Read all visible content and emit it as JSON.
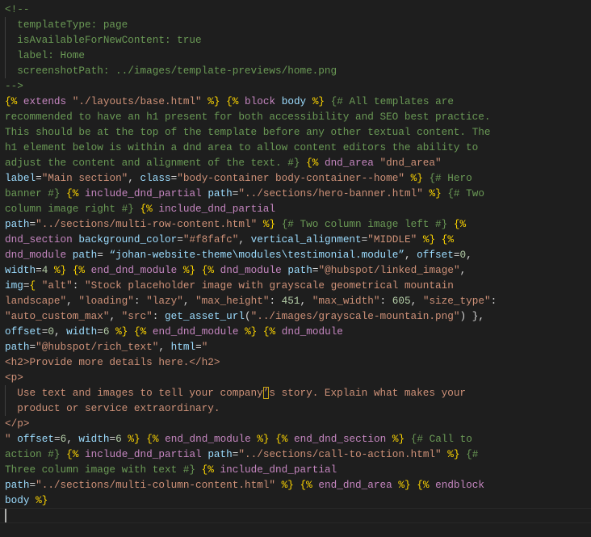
{
  "editor": {
    "lines": [
      [
        [
          "c",
          "<!--"
        ]
      ],
      [
        [
          "c",
          "  templateType: page"
        ]
      ],
      [
        [
          "c",
          "  isAvailableForNewContent: true"
        ]
      ],
      [
        [
          "c",
          "  label: Home"
        ]
      ],
      [
        [
          "c",
          "  screenshotPath: ../images/template-previews/home.png"
        ]
      ],
      [
        [
          "c",
          "-->"
        ]
      ],
      [
        [
          "b",
          "{%"
        ],
        [
          "p",
          " "
        ],
        [
          "k",
          "extends"
        ],
        [
          "p",
          " "
        ],
        [
          "s",
          "\"./layouts/base.html\""
        ],
        [
          "p",
          " "
        ],
        [
          "b",
          "%}"
        ],
        [
          "p",
          " "
        ],
        [
          "b",
          "{%"
        ],
        [
          "p",
          " "
        ],
        [
          "k",
          "block"
        ],
        [
          "p",
          " "
        ],
        [
          "v",
          "body"
        ],
        [
          "p",
          " "
        ],
        [
          "b",
          "%}"
        ],
        [
          "p",
          " "
        ],
        [
          "c",
          "{# All templates are"
        ]
      ],
      [
        [
          "c",
          "recommended to have an h1 present for both accessibility and SEO best practice."
        ]
      ],
      [
        [
          "c",
          "This should be at the top of the template before any other textual content. The"
        ]
      ],
      [
        [
          "c",
          "h1 element below is within a dnd area to allow content editors the ability to"
        ]
      ],
      [
        [
          "c",
          "adjust the content and alignment of the text. #}"
        ],
        [
          "p",
          " "
        ],
        [
          "b",
          "{%"
        ],
        [
          "p",
          " "
        ],
        [
          "k",
          "dnd_area"
        ],
        [
          "p",
          " "
        ],
        [
          "s",
          "\"dnd_area\""
        ]
      ],
      [
        [
          "v",
          "label"
        ],
        [
          "p",
          "="
        ],
        [
          "s",
          "\"Main section\""
        ],
        [
          "p",
          ", "
        ],
        [
          "v",
          "class"
        ],
        [
          "p",
          "="
        ],
        [
          "s",
          "\"body-container body-container--home\""
        ],
        [
          "p",
          " "
        ],
        [
          "b",
          "%}"
        ],
        [
          "p",
          " "
        ],
        [
          "c",
          "{# Hero"
        ]
      ],
      [
        [
          "c",
          "banner #}"
        ],
        [
          "p",
          " "
        ],
        [
          "b",
          "{%"
        ],
        [
          "p",
          " "
        ],
        [
          "k",
          "include_dnd_partial"
        ],
        [
          "p",
          " "
        ],
        [
          "v",
          "path"
        ],
        [
          "p",
          "="
        ],
        [
          "s",
          "\"../sections/hero-banner.html\""
        ],
        [
          "p",
          " "
        ],
        [
          "b",
          "%}"
        ],
        [
          "p",
          " "
        ],
        [
          "c",
          "{# Two"
        ]
      ],
      [
        [
          "c",
          "column image right #}"
        ],
        [
          "p",
          " "
        ],
        [
          "b",
          "{%"
        ],
        [
          "p",
          " "
        ],
        [
          "k",
          "include_dnd_partial"
        ]
      ],
      [
        [
          "v",
          "path"
        ],
        [
          "p",
          "="
        ],
        [
          "s",
          "\"../sections/multi-row-content.html\""
        ],
        [
          "p",
          " "
        ],
        [
          "b",
          "%}"
        ],
        [
          "p",
          " "
        ],
        [
          "c",
          "{# Two column image left #}"
        ],
        [
          "p",
          " "
        ],
        [
          "b",
          "{%"
        ]
      ],
      [
        [
          "k",
          "dnd_section"
        ],
        [
          "p",
          " "
        ],
        [
          "v",
          "background_color"
        ],
        [
          "p",
          "="
        ],
        [
          "s",
          "\"#f8fafc\""
        ],
        [
          "p",
          ", "
        ],
        [
          "v",
          "vertical_alignment"
        ],
        [
          "p",
          "="
        ],
        [
          "s",
          "\"MIDDLE\""
        ],
        [
          "p",
          " "
        ],
        [
          "b",
          "%}"
        ],
        [
          "p",
          " "
        ],
        [
          "b",
          "{%"
        ]
      ],
      [
        [
          "k",
          "dnd_module"
        ],
        [
          "p",
          " "
        ],
        [
          "v",
          "path"
        ],
        [
          "p",
          "= "
        ],
        [
          "v",
          "“johan-website-theme\\modules\\testimonial.module”"
        ],
        [
          "p",
          ", "
        ],
        [
          "v",
          "offset"
        ],
        [
          "p",
          "="
        ],
        [
          "n",
          "0"
        ],
        [
          "p",
          ","
        ]
      ],
      [
        [
          "v",
          "width"
        ],
        [
          "p",
          "="
        ],
        [
          "n",
          "4"
        ],
        [
          "p",
          " "
        ],
        [
          "b",
          "%}"
        ],
        [
          "p",
          " "
        ],
        [
          "b",
          "{%"
        ],
        [
          "p",
          " "
        ],
        [
          "k",
          "end_dnd_module"
        ],
        [
          "p",
          " "
        ],
        [
          "b",
          "%}"
        ],
        [
          "p",
          " "
        ],
        [
          "b",
          "{%"
        ],
        [
          "p",
          " "
        ],
        [
          "k",
          "dnd_module"
        ],
        [
          "p",
          " "
        ],
        [
          "v",
          "path"
        ],
        [
          "p",
          "="
        ],
        [
          "s",
          "\"@hubspot/linked_image\""
        ],
        [
          "p",
          ","
        ]
      ],
      [
        [
          "v",
          "img"
        ],
        [
          "p",
          "="
        ],
        [
          "b",
          "{"
        ],
        [
          "p",
          " "
        ],
        [
          "s",
          "\"alt\""
        ],
        [
          "p",
          ": "
        ],
        [
          "s",
          "\"Stock placeholder image with grayscale geometrical mountain"
        ]
      ],
      [
        [
          "s",
          "landscape\""
        ],
        [
          "p",
          ", "
        ],
        [
          "s",
          "\"loading\""
        ],
        [
          "p",
          ": "
        ],
        [
          "s",
          "\"lazy\""
        ],
        [
          "p",
          ", "
        ],
        [
          "s",
          "\"max_height\""
        ],
        [
          "p",
          ": "
        ],
        [
          "n",
          "451"
        ],
        [
          "p",
          ", "
        ],
        [
          "s",
          "\"max_width\""
        ],
        [
          "p",
          ": "
        ],
        [
          "n",
          "605"
        ],
        [
          "p",
          ", "
        ],
        [
          "s",
          "\"size_type\""
        ],
        [
          "p",
          ":"
        ]
      ],
      [
        [
          "s",
          "\"auto_custom_max\""
        ],
        [
          "p",
          ", "
        ],
        [
          "s",
          "\"src\""
        ],
        [
          "p",
          ": "
        ],
        [
          "v",
          "get_asset_url"
        ],
        [
          "p",
          "("
        ],
        [
          "s",
          "\"../images/grayscale-mountain.png\""
        ],
        [
          "p",
          ") }"
        ],
        [
          "p",
          ","
        ]
      ],
      [
        [
          "v",
          "offset"
        ],
        [
          "p",
          "="
        ],
        [
          "n",
          "0"
        ],
        [
          "p",
          ", "
        ],
        [
          "v",
          "width"
        ],
        [
          "p",
          "="
        ],
        [
          "n",
          "6"
        ],
        [
          "p",
          " "
        ],
        [
          "b",
          "%}"
        ],
        [
          "p",
          " "
        ],
        [
          "b",
          "{%"
        ],
        [
          "p",
          " "
        ],
        [
          "k",
          "end_dnd_module"
        ],
        [
          "p",
          " "
        ],
        [
          "b",
          "%}"
        ],
        [
          "p",
          " "
        ],
        [
          "b",
          "{%"
        ],
        [
          "p",
          " "
        ],
        [
          "k",
          "dnd_module"
        ]
      ],
      [
        [
          "v",
          "path"
        ],
        [
          "p",
          "="
        ],
        [
          "s",
          "\"@hubspot/rich_text\""
        ],
        [
          "p",
          ", "
        ],
        [
          "v",
          "html"
        ],
        [
          "p",
          "="
        ],
        [
          "s",
          "\""
        ]
      ],
      [
        [
          "s",
          "<h2>Provide more details here.</h2>"
        ]
      ],
      [
        [
          "s",
          "<p>"
        ]
      ],
      [
        [
          "s",
          "  Use text and images to tell your company"
        ],
        [
          "hl",
          "’"
        ],
        [
          "s",
          "s story. Explain what makes your"
        ]
      ],
      [
        [
          "s",
          "  product or service extraordinary."
        ]
      ],
      [
        [
          "s",
          "</p>"
        ]
      ],
      [
        [
          "s",
          "\""
        ],
        [
          "p",
          " "
        ],
        [
          "v",
          "offset"
        ],
        [
          "p",
          "="
        ],
        [
          "n",
          "6"
        ],
        [
          "p",
          ", "
        ],
        [
          "v",
          "width"
        ],
        [
          "p",
          "="
        ],
        [
          "n",
          "6"
        ],
        [
          "p",
          " "
        ],
        [
          "b",
          "%}"
        ],
        [
          "p",
          " "
        ],
        [
          "b",
          "{%"
        ],
        [
          "p",
          " "
        ],
        [
          "k",
          "end_dnd_module"
        ],
        [
          "p",
          " "
        ],
        [
          "b",
          "%}"
        ],
        [
          "p",
          " "
        ],
        [
          "b",
          "{%"
        ],
        [
          "p",
          " "
        ],
        [
          "k",
          "end_dnd_section"
        ],
        [
          "p",
          " "
        ],
        [
          "b",
          "%}"
        ],
        [
          "p",
          " "
        ],
        [
          "c",
          "{# Call to"
        ]
      ],
      [
        [
          "c",
          "action #}"
        ],
        [
          "p",
          " "
        ],
        [
          "b",
          "{%"
        ],
        [
          "p",
          " "
        ],
        [
          "k",
          "include_dnd_partial"
        ],
        [
          "p",
          " "
        ],
        [
          "v",
          "path"
        ],
        [
          "p",
          "="
        ],
        [
          "s",
          "\"../sections/call-to-action.html\""
        ],
        [
          "p",
          " "
        ],
        [
          "b",
          "%}"
        ],
        [
          "p",
          " "
        ],
        [
          "c",
          "{#"
        ]
      ],
      [
        [
          "c",
          "Three column image with text #}"
        ],
        [
          "p",
          " "
        ],
        [
          "b",
          "{%"
        ],
        [
          "p",
          " "
        ],
        [
          "k",
          "include_dnd_partial"
        ]
      ],
      [
        [
          "v",
          "path"
        ],
        [
          "p",
          "="
        ],
        [
          "s",
          "\"../sections/multi-column-content.html\""
        ],
        [
          "p",
          " "
        ],
        [
          "b",
          "%}"
        ],
        [
          "p",
          " "
        ],
        [
          "b",
          "{%"
        ],
        [
          "p",
          " "
        ],
        [
          "k",
          "end_dnd_area"
        ],
        [
          "p",
          " "
        ],
        [
          "b",
          "%}"
        ],
        [
          "p",
          " "
        ],
        [
          "b",
          "{%"
        ],
        [
          "p",
          " "
        ],
        [
          "k",
          "endblock"
        ]
      ],
      [
        [
          "v",
          "body"
        ],
        [
          "p",
          " "
        ],
        [
          "b",
          "%}"
        ]
      ],
      []
    ]
  }
}
